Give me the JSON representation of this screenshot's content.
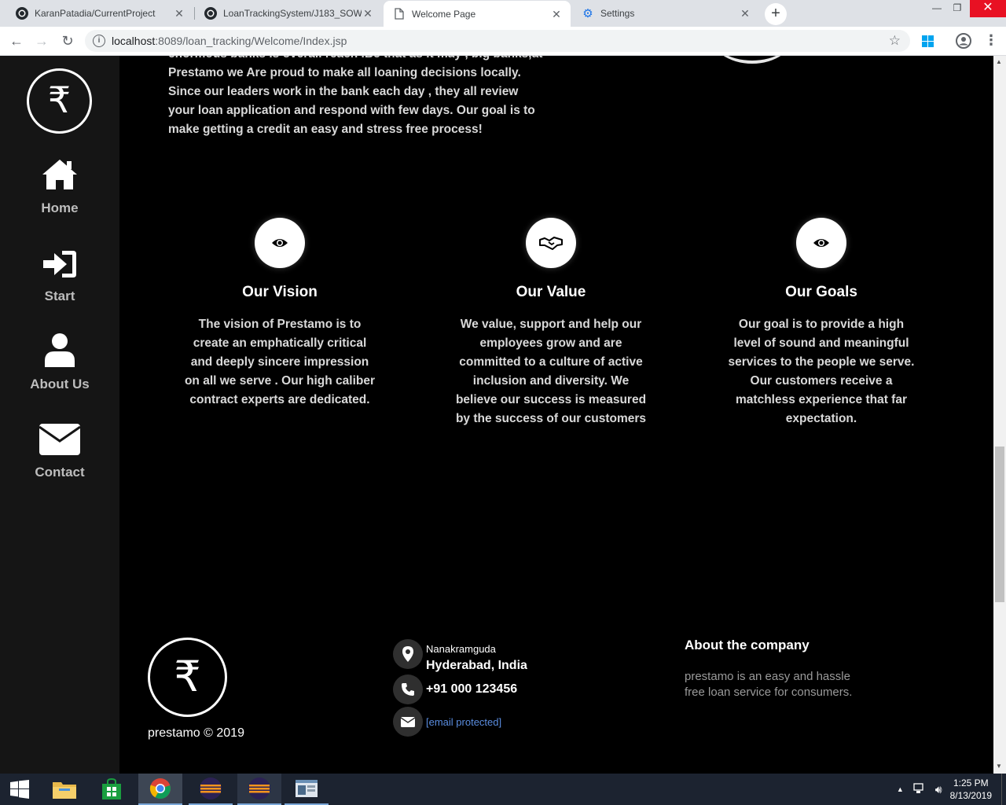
{
  "browser": {
    "tabs": [
      {
        "title": "KaranPatadia/CurrentProject",
        "icon": "github-icon",
        "active": false
      },
      {
        "title": "LoanTrackingSystem/J183_SOW",
        "icon": "github-icon",
        "active": false
      },
      {
        "title": "Welcome Page",
        "icon": "page-icon",
        "active": true
      },
      {
        "title": "Settings",
        "icon": "gear-icon",
        "active": false
      }
    ],
    "url_host": "localhost",
    "url_rest": ":8089/loan_tracking/Welcome/Index.jsp"
  },
  "sidebar": {
    "logo_symbol": "₹",
    "items": [
      {
        "label": "Home",
        "icon": "home-icon"
      },
      {
        "label": "Start",
        "icon": "sign-in-icon"
      },
      {
        "label": "About Us",
        "icon": "user-icon"
      },
      {
        "label": "Contact",
        "icon": "envelope-icon"
      }
    ]
  },
  "intro": {
    "text": "enormous banks is overall reach .Be that as it may , big banks,at Prestamo we Are proud to make all loaning decisions locally. Since our leaders work in the bank each day , they all review your loan application and respond with few days. Our goal is to make getting a credit an easy and stress free process!"
  },
  "features": [
    {
      "title": "Our Vision",
      "icon": "eye-icon",
      "text": "The vision of Prestamo is to create an emphatically critical and deeply sincere impression on all we serve . Our high caliber contract experts are dedicated."
    },
    {
      "title": "Our Value",
      "icon": "handshake-icon",
      "text": "We value, support and help our employees grow and are committed to a culture of active inclusion and diversity. We believe our success is measured by the success of our customers"
    },
    {
      "title": "Our Goals",
      "icon": "eye-icon",
      "text": "Our goal is to provide a high level of sound and meaningful services to the people we serve. Our customers receive a matchless experience that far expectation."
    }
  ],
  "footer": {
    "logo_symbol": "₹",
    "copyright": "prestamo © 2019",
    "address_line1": "Nanakramguda",
    "address_line2": "Hyderabad, India",
    "phone": "+91 000 123456",
    "email": "[email protected]",
    "about_title": "About the company",
    "about_text": "prestamo is an easy and hassle free loan service for consumers."
  },
  "taskbar": {
    "time": "1:25 PM",
    "date": "8/13/2019"
  }
}
